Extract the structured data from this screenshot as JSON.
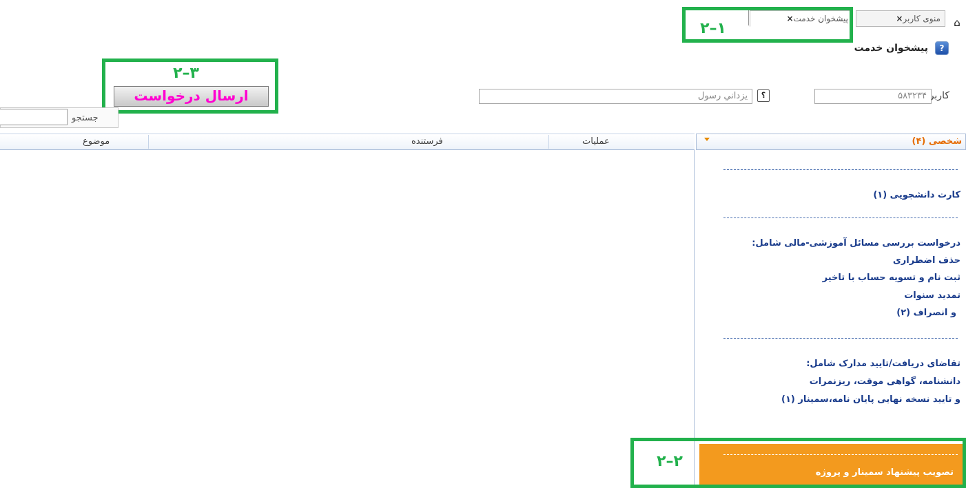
{
  "tabs": {
    "home_icon": "home-icon",
    "user_menu": "منوی کاربر",
    "service": "پیشخوان خدمت",
    "close": "×"
  },
  "header": {
    "title": "پیشخوان خدمت",
    "help_icon": "?"
  },
  "user": {
    "label": "کاربر",
    "code": "۵۸۳۲۳۴",
    "lookup": "؟",
    "name": "يزداني رسول"
  },
  "actions": {
    "send_request": "ارسال درخواست"
  },
  "search": {
    "label": "جستجو",
    "value": ""
  },
  "grid": {
    "columns": [
      "عملیات",
      "فرستنده",
      "موضوع"
    ]
  },
  "panel": {
    "title": "شخصی (۴)",
    "items": [
      "کارت دانشجویی (۱)",
      "درخواست بررسی مسائل آموزشی-مالی شامل:",
      "حذف اضطراری",
      "ثبت نام و تسویه حساب با تاخیر",
      "تمدید سنوات",
      "و انصراف (۲)",
      "تقاضای دریافت/تایید مدارک شامل:",
      "دانشنامه، گواهی موقت، ریزنمرات",
      "و تایید نسخه نهایی پایان نامه،سمینار (۱)",
      "تصویب پیشنهاد سمینار و پروژه"
    ]
  },
  "annotations": {
    "a1": "۲–۱",
    "a2": "۲–۲",
    "a3": "۲–۳",
    "color": "#22b14c"
  },
  "colors": {
    "highlight": "#f39a1e",
    "send_text": "#ff00d0",
    "panel_title": "#e56b00",
    "link": "#1a3c8c"
  }
}
